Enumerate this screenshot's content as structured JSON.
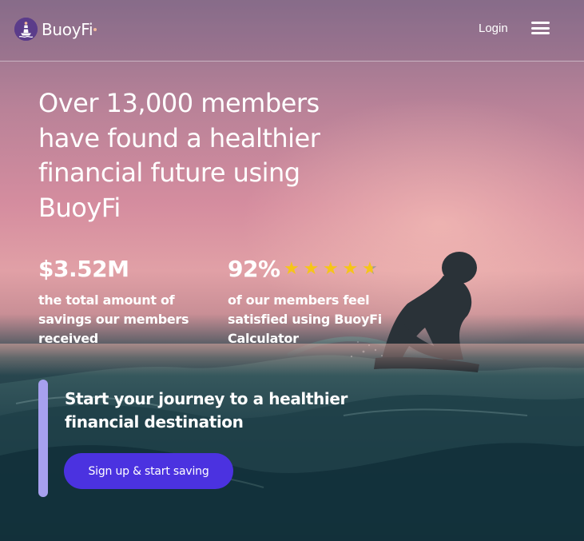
{
  "brand": {
    "name": "BuoyFi"
  },
  "header": {
    "login_label": "Login"
  },
  "hero": {
    "headline": "Over 13,000 members have found a healthier financial future using BuoyFi",
    "stats": [
      {
        "value": "$3.52M",
        "description": "the total amount of savings our members received"
      },
      {
        "value": "92%",
        "description": "of our members feel satisfied using BuoyFi Calculator",
        "rating": 4.5,
        "rating_max": 5
      }
    ],
    "cta": {
      "title": "Start your journey to a healthier financial destination",
      "button_label": "Sign up & start saving"
    }
  },
  "colors": {
    "accent": "#4b32e0",
    "cta_bar": "#a7a0ef",
    "star": "#f5c518",
    "logo_bg": "#5b3c8a"
  },
  "icons": [
    "buoy-logo-icon",
    "hamburger-menu-icon",
    "star-icon"
  ]
}
